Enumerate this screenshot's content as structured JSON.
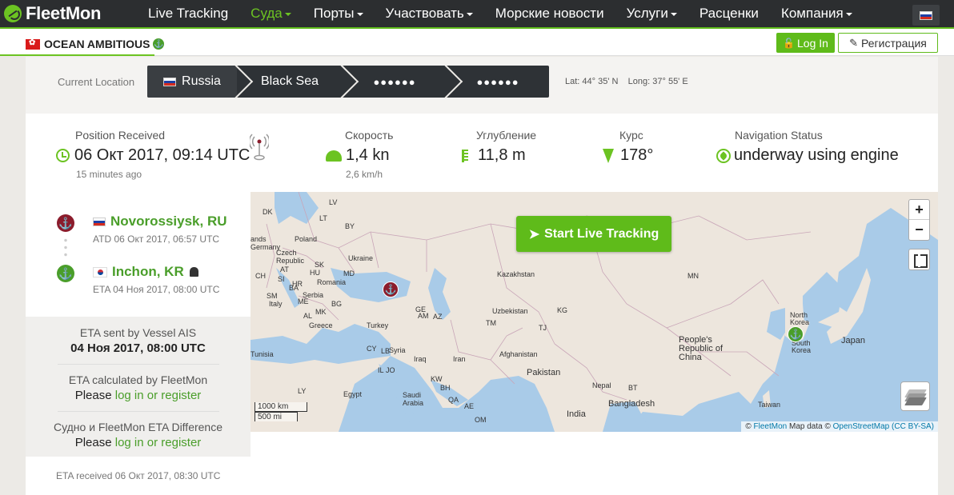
{
  "nav": {
    "logo": "FleetMon",
    "items": [
      {
        "label": "Live Tracking",
        "active": false,
        "caret": false
      },
      {
        "label": "Суда",
        "active": true,
        "caret": true
      },
      {
        "label": "Порты",
        "active": false,
        "caret": true
      },
      {
        "label": "Участвовать",
        "active": false,
        "caret": true
      },
      {
        "label": "Морские новости",
        "active": false,
        "caret": false
      },
      {
        "label": "Услуги",
        "active": false,
        "caret": true
      },
      {
        "label": "Расценки",
        "active": false,
        "caret": false
      },
      {
        "label": "Компания",
        "active": false,
        "caret": true
      }
    ]
  },
  "vessel": {
    "name": "OCEAN AMBITIOUS"
  },
  "auth": {
    "login": "Log In",
    "register": "Регистрация"
  },
  "location": {
    "label": "Current Location",
    "crumbs": [
      "Russia",
      "Black Sea",
      "●●●●●●",
      "●●●●●●"
    ],
    "lat": "Lat: 44° 35' N",
    "long": "Long: 37° 55' E"
  },
  "stats": {
    "position": {
      "label": "Position Received",
      "value": "06 Окт 2017, 09:14 UTC",
      "sub": "15 minutes ago"
    },
    "speed": {
      "label": "Скорость",
      "value": "1,4 kn",
      "sub": "2,6 km/h"
    },
    "draught": {
      "label": "Углубление",
      "value": "11,8 m"
    },
    "course": {
      "label": "Курс",
      "value": "178°"
    },
    "nav_status": {
      "label": "Navigation Status",
      "value": "underway using engine"
    }
  },
  "route": {
    "departure": {
      "port": "Novorossiysk, RU",
      "sub": "ATD 06 Окт 2017, 06:57 UTC"
    },
    "arrival": {
      "port": "Inchon, KR",
      "sub": "ETA 04 Ноя 2017, 08:00 UTC"
    }
  },
  "eta": {
    "ais_label": "ETA sent by Vessel AIS",
    "ais_value": "04 Ноя 2017, 08:00 UTC",
    "fm_label": "ETA calculated by FleetMon",
    "diff_label": "Судно и FleetMon ETA Difference",
    "please": "Please",
    "link": "log in or register",
    "received": "ETA received 06 Окт 2017, 08:30 UTC"
  },
  "map": {
    "start_button": "Start Live Tracking",
    "zoom_in": "+",
    "zoom_out": "−",
    "scale_km": "1000 km",
    "scale_mi": "500 mi",
    "attribution": {
      "copy": "©",
      "fleetmon": "FleetMon",
      "mapdata": "Map data ©",
      "osm": "OpenStreetMap",
      "license": "(CC BY-SA)"
    },
    "labels": [
      {
        "t": "DK"
      },
      {
        "t": "LV"
      },
      {
        "t": "LT"
      },
      {
        "t": "BY"
      },
      {
        "t": "Poland"
      },
      {
        "t": "Germany"
      },
      {
        "t": "Czech Republic"
      },
      {
        "t": "Ukraine"
      },
      {
        "t": "SK"
      },
      {
        "t": "AT"
      },
      {
        "t": "HU"
      },
      {
        "t": "MD"
      },
      {
        "t": "CH"
      },
      {
        "t": "SI"
      },
      {
        "t": "HR"
      },
      {
        "t": "Romania"
      },
      {
        "t": "BA"
      },
      {
        "t": "Serbia"
      },
      {
        "t": "SM"
      },
      {
        "t": "ME"
      },
      {
        "t": "BG"
      },
      {
        "t": "Italy"
      },
      {
        "t": "MK"
      },
      {
        "t": "AL"
      },
      {
        "t": "Greece"
      },
      {
        "t": "Turkey"
      },
      {
        "t": "Tunisia"
      },
      {
        "t": "CY"
      },
      {
        "t": "LB"
      },
      {
        "t": "Syria"
      },
      {
        "t": "IL"
      },
      {
        "t": "JO"
      },
      {
        "t": "Iraq"
      },
      {
        "t": "Iran"
      },
      {
        "t": "GE"
      },
      {
        "t": "AM"
      },
      {
        "t": "AZ"
      },
      {
        "t": "Kazakhstan"
      },
      {
        "t": "Uzbekistan"
      },
      {
        "t": "TM"
      },
      {
        "t": "KG"
      },
      {
        "t": "TJ"
      },
      {
        "t": "Afghanistan"
      },
      {
        "t": "Pakistan"
      },
      {
        "t": "KW"
      },
      {
        "t": "BH"
      },
      {
        "t": "QA"
      },
      {
        "t": "AE"
      },
      {
        "t": "OM"
      },
      {
        "t": "Saudi Arabia"
      },
      {
        "t": "Egypt"
      },
      {
        "t": "LY"
      },
      {
        "t": "India"
      },
      {
        "t": "Nepal"
      },
      {
        "t": "BT"
      },
      {
        "t": "Bangladesh"
      },
      {
        "t": "People's Republic of China"
      },
      {
        "t": "MN"
      },
      {
        "t": "North Korea"
      },
      {
        "t": "South Korea"
      },
      {
        "t": "Japan"
      },
      {
        "t": "Taiwan"
      },
      {
        "t": "ands"
      }
    ]
  },
  "colors": {
    "accent": "#5fbb1a",
    "nav_bg": "#2c2e30",
    "departure": "#8b1c2c",
    "arrival": "#4a9e2a",
    "water": "#a9cbe8",
    "land": "#ede6dd"
  }
}
